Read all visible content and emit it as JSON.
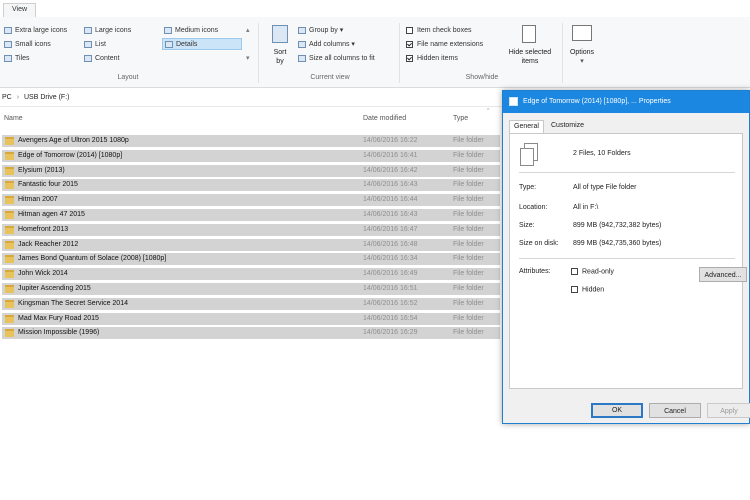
{
  "ribbon": {
    "tab": "View",
    "layout": {
      "items": [
        "Extra large icons",
        "Large icons",
        "Medium icons",
        "Small icons",
        "List",
        "Details",
        "Tiles",
        "Content"
      ],
      "selected": "Details",
      "label": "Layout"
    },
    "current_view": {
      "sort_by_line1": "Sort",
      "sort_by_line2": "by",
      "group_by": "Group by",
      "add_columns": "Add columns",
      "size_all_columns": "Size all columns to fit",
      "label": "Current view"
    },
    "show_hide": {
      "item_check_boxes": "Item check boxes",
      "file_name_extensions": "File name extensions",
      "hidden_items": "Hidden items",
      "hide_selected_line1": "Hide selected",
      "hide_selected_line2": "items",
      "label": "Show/hide"
    },
    "options": "Options"
  },
  "address": {
    "crumb_pc": "PC",
    "crumb_drive": "USB Drive (F:)"
  },
  "list": {
    "headers": {
      "name": "Name",
      "date": "Date modified",
      "type": "Type"
    },
    "rows": [
      {
        "name": "Avengers Age of Ultron 2015 1080p",
        "date": "14/06/2016 16:22",
        "type": "File folder"
      },
      {
        "name": "Edge of Tomorrow (2014) [1080p]",
        "date": "14/06/2016 16:41",
        "type": "File folder"
      },
      {
        "name": "Elysium (2013)",
        "date": "14/06/2016 16:42",
        "type": "File folder"
      },
      {
        "name": "Fantastic four 2015",
        "date": "14/06/2016 16:43",
        "type": "File folder"
      },
      {
        "name": "Hitman 2007",
        "date": "14/06/2016 16:44",
        "type": "File folder"
      },
      {
        "name": "Hitman agen 47 2015",
        "date": "14/06/2016 16:43",
        "type": "File folder"
      },
      {
        "name": "Homefront 2013",
        "date": "14/06/2016 16:47",
        "type": "File folder"
      },
      {
        "name": "Jack Reacher 2012",
        "date": "14/06/2016 16:48",
        "type": "File folder"
      },
      {
        "name": "James Bond Quantum of Solace (2008) [1080p]",
        "date": "14/06/2016 16:34",
        "type": "File folder"
      },
      {
        "name": "John Wick 2014",
        "date": "14/06/2016 16:49",
        "type": "File folder"
      },
      {
        "name": "Jupiter Ascending 2015",
        "date": "14/06/2016 16:51",
        "type": "File folder"
      },
      {
        "name": "Kingsman The Secret Service 2014",
        "date": "14/06/2016 16:52",
        "type": "File folder"
      },
      {
        "name": "Mad Max Fury Road 2015",
        "date": "14/06/2016 16:54",
        "type": "File folder"
      },
      {
        "name": "Mission Impossible (1996)",
        "date": "14/06/2016 16:29",
        "type": "File folder"
      }
    ]
  },
  "dialog": {
    "title": "Edge of Tomorrow (2014) [1080p], ... Properties",
    "tabs": [
      "General",
      "Customize"
    ],
    "contains": "2 Files, 10 Folders",
    "type_label": "Type:",
    "type_value": "All of type File folder",
    "location_label": "Location:",
    "location_value": "All in F:\\",
    "size_label": "Size:",
    "size_value": "899 MB (942,732,382 bytes)",
    "size_on_disk_label": "Size on disk:",
    "size_on_disk_value": "899 MB (942,735,360 bytes)",
    "attributes_label": "Attributes:",
    "read_only": "Read-only",
    "hidden": "Hidden",
    "advanced": "Advanced...",
    "ok": "OK",
    "cancel": "Cancel",
    "apply": "Apply"
  },
  "colors": {
    "accent": "#1b87e0",
    "selection": "#d3d3d3"
  }
}
